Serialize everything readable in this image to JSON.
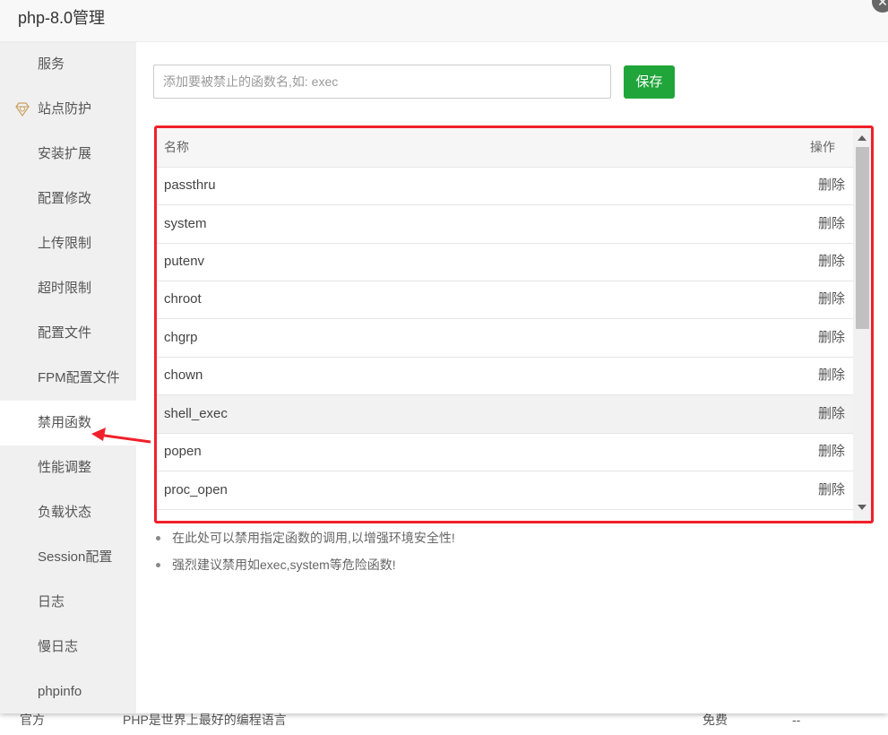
{
  "window": {
    "title": "php-8.0管理"
  },
  "sidebar": {
    "items": [
      {
        "label": "服务"
      },
      {
        "label": "站点防护",
        "icon": "diamond-icon"
      },
      {
        "label": "安装扩展"
      },
      {
        "label": "配置修改"
      },
      {
        "label": "上传限制"
      },
      {
        "label": "超时限制"
      },
      {
        "label": "配置文件"
      },
      {
        "label": "FPM配置文件"
      },
      {
        "label": "禁用函数",
        "active": true
      },
      {
        "label": "性能调整"
      },
      {
        "label": "负载状态"
      },
      {
        "label": "Session配置"
      },
      {
        "label": "日志"
      },
      {
        "label": "慢日志"
      },
      {
        "label": "phpinfo"
      }
    ]
  },
  "search": {
    "placeholder": "添加要被禁止的函数名,如: exec",
    "value": ""
  },
  "save_label": "保存",
  "table": {
    "headers": {
      "name": "名称",
      "action": "操作"
    },
    "rows": [
      {
        "name": "passthru",
        "action": "删除"
      },
      {
        "name": "system",
        "action": "删除"
      },
      {
        "name": "putenv",
        "action": "删除"
      },
      {
        "name": "chroot",
        "action": "删除"
      },
      {
        "name": "chgrp",
        "action": "删除"
      },
      {
        "name": "chown",
        "action": "删除"
      },
      {
        "name": "shell_exec",
        "action": "删除"
      },
      {
        "name": "popen",
        "action": "删除"
      },
      {
        "name": "proc_open",
        "action": "删除"
      }
    ]
  },
  "tips": [
    "在此处可以禁用指定函数的调用,以增强环境安全性!",
    "强烈建议禁用如exec,system等危险函数!"
  ],
  "background_row": {
    "c1": "官方",
    "c2": "PHP是世界上最好的编程语言",
    "c3": "免费",
    "c4": "--"
  },
  "colors": {
    "accent": "#20a53a",
    "highlight_border": "#f0202a",
    "sidebar_bg": "#f0f0f0"
  }
}
